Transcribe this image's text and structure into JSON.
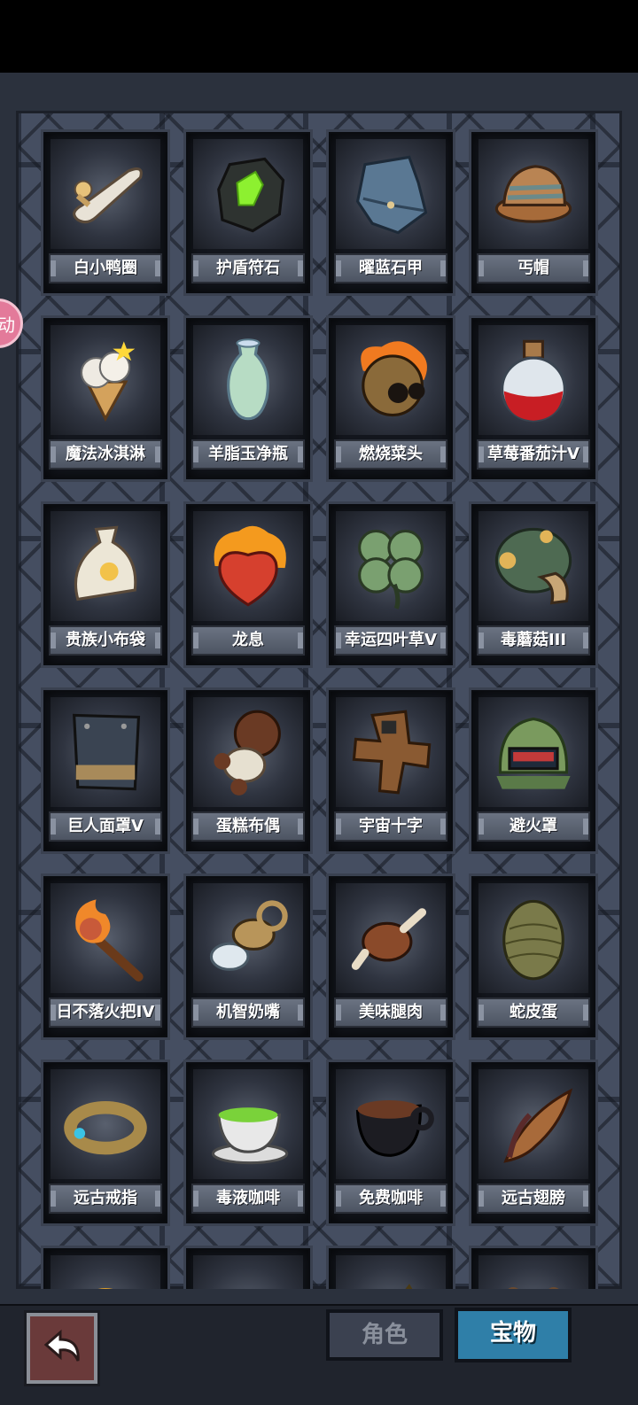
{
  "side_badge": {
    "text": "动"
  },
  "items": [
    {
      "name": "白小鸭圈",
      "icon": "duck-ring-icon"
    },
    {
      "name": "护盾符石",
      "icon": "shield-rune-stone-icon"
    },
    {
      "name": "曜蓝石甲",
      "icon": "blue-stone-armor-icon"
    },
    {
      "name": "丐帽",
      "icon": "beggar-hat-icon"
    },
    {
      "name": "魔法冰淇淋",
      "icon": "magic-ice-cream-icon"
    },
    {
      "name": "羊脂玉净瓶",
      "icon": "jade-vase-icon"
    },
    {
      "name": "燃烧菜头",
      "icon": "burning-vegetable-icon"
    },
    {
      "name": "草莓番茄汁V",
      "icon": "strawberry-potion-icon"
    },
    {
      "name": "贵族小布袋",
      "icon": "noble-bag-icon"
    },
    {
      "name": "龙息",
      "icon": "dragon-breath-heart-icon"
    },
    {
      "name": "幸运四叶草V",
      "icon": "four-leaf-clover-icon"
    },
    {
      "name": "毒蘑菇III",
      "icon": "poison-mushroom-icon"
    },
    {
      "name": "巨人面罩V",
      "icon": "giant-mask-icon"
    },
    {
      "name": "蛋糕布偶",
      "icon": "cake-doll-icon"
    },
    {
      "name": "宇宙十字",
      "icon": "cosmic-cross-icon"
    },
    {
      "name": "避火罩",
      "icon": "fire-helmet-icon"
    },
    {
      "name": "日不落火把IV",
      "icon": "torch-icon"
    },
    {
      "name": "机智奶嘴",
      "icon": "pacifier-icon"
    },
    {
      "name": "美味腿肉",
      "icon": "drumstick-icon"
    },
    {
      "name": "蛇皮蛋",
      "icon": "snakeskin-egg-icon"
    },
    {
      "name": "远古戒指",
      "icon": "ancient-ring-icon"
    },
    {
      "name": "毒液咖啡",
      "icon": "venom-coffee-icon"
    },
    {
      "name": "免费咖啡",
      "icon": "free-coffee-icon"
    },
    {
      "name": "远古翅膀",
      "icon": "ancient-wing-icon"
    }
  ],
  "partial_items": [
    {
      "icon": "golden-bun-icon"
    },
    {
      "icon": "silver-bowl-icon"
    },
    {
      "icon": "gold-pile-icon"
    },
    {
      "icon": "teddy-bear-icon"
    }
  ],
  "bottom": {
    "back_icon": "back-arrow-icon",
    "tabs": [
      {
        "label": "角色",
        "active": false
      },
      {
        "label": "宝物",
        "active": true
      }
    ]
  }
}
